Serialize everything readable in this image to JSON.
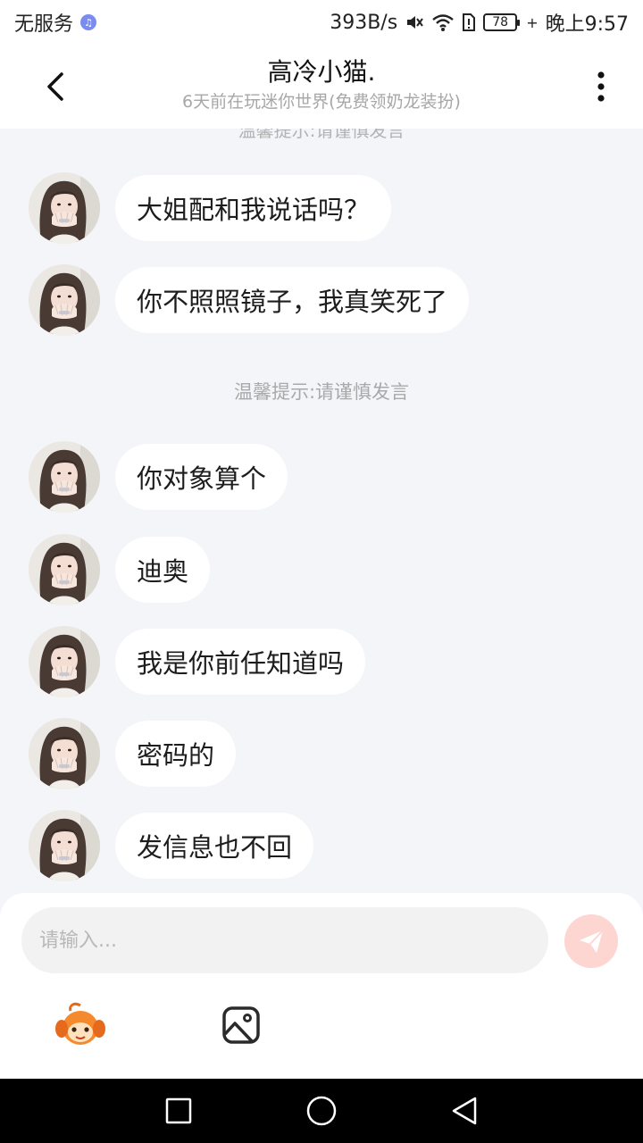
{
  "status_bar": {
    "carrier": "无服务",
    "net_speed": "393B/s",
    "battery": "78",
    "time": "晚上9:57",
    "icons": [
      "music-icon",
      "mute-icon",
      "wifi-icon",
      "sim-alert-icon",
      "battery-icon",
      "charging-icon"
    ]
  },
  "header": {
    "title": "高冷小猫.",
    "subtitle": "6天前在玩迷你世界(免费领奶龙装扮)",
    "icons": [
      "back-arrow-icon",
      "more-vertical-icon"
    ]
  },
  "messages": {
    "items": [
      {
        "text": "大姐配和我说话吗？"
      },
      {
        "text": "你不照照镜子，我真笑死了"
      },
      {
        "text": "你对象算个"
      },
      {
        "text": "迪奥"
      },
      {
        "text": "我是你前任知道吗"
      },
      {
        "text": "密码的"
      },
      {
        "text": "发信息也不回"
      }
    ],
    "system_tip": "温馨提示:请谨慎发言"
  },
  "composer": {
    "placeholder": "请输入...",
    "icons": [
      "send-icon",
      "emoji-mascot-icon",
      "image-icon"
    ],
    "send_color": "#fdd6d2"
  },
  "nav_bar": {
    "icons": [
      "recent-apps-icon",
      "home-icon",
      "back-icon"
    ]
  }
}
